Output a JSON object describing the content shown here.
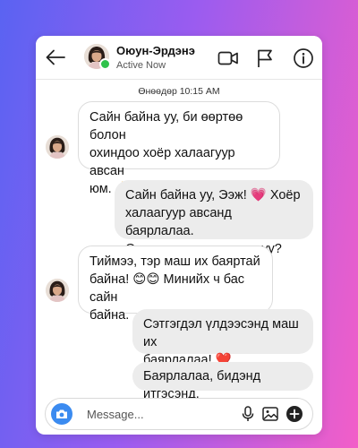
{
  "colors": {
    "background_start": "#5a63f2",
    "background_end": "#f25ec8",
    "online": "#2fc24b",
    "camera_button": "#3b8bf0",
    "outgoing_bubble": "#ececec",
    "incoming_bubble": "#ffffff"
  },
  "header": {
    "back_icon": "arrow-left-icon",
    "contact_name": "Оюун-Эрдэнэ",
    "status": "Active Now",
    "icons": [
      "video-camera-icon",
      "flag-icon",
      "info-icon"
    ]
  },
  "conversation": {
    "timestamp": "Өнөөдөр 10:15 AM",
    "messages": [
      {
        "direction": "incoming",
        "lines": [
          "Сайн байна уу, би өөртөө болон",
          "охиндоо хоёр халаагуур авсан",
          "юм. 🙏"
        ]
      },
      {
        "direction": "outgoing",
        "lines": [
          "Сайн байна уу, Ээж! 💗 Хоёр",
          "халаагуур авсанд баярлалаа.",
          "Охин тань таалагдсан уу?"
        ]
      },
      {
        "direction": "incoming",
        "lines": [
          "Тиймээ, тэр маш их баяртай",
          "байна! 😊😊 Минийх ч бас сайн",
          "байна."
        ]
      },
      {
        "direction": "outgoing",
        "lines": [
          "Сэтгэгдэл үлдээсэнд маш их",
          "баярлалаа! ❤️"
        ]
      },
      {
        "direction": "outgoing",
        "lines": [
          "Баярлалаа, бидэнд итгэсэнд."
        ]
      }
    ]
  },
  "composer": {
    "placeholder": "Message...",
    "icons": [
      "camera-icon",
      "microphone-icon",
      "gallery-icon",
      "add-icon"
    ]
  }
}
